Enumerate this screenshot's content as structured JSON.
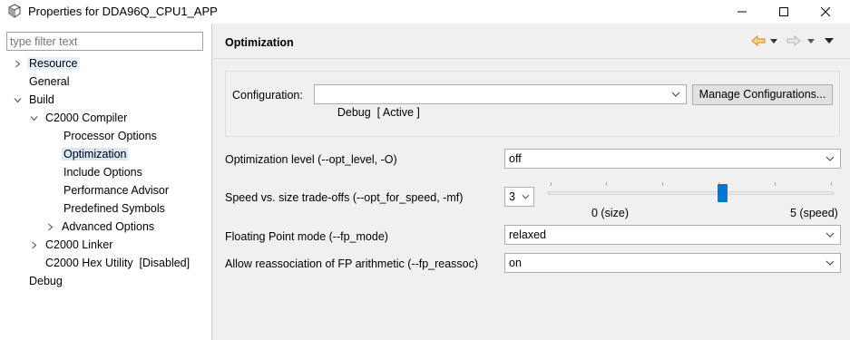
{
  "window": {
    "title": "Properties for DDA96Q_CPU1_APP",
    "minimize_icon": "minimize-icon",
    "maximize_icon": "maximize-icon",
    "close_icon": "close-icon"
  },
  "filter": {
    "placeholder": "type filter text"
  },
  "tree": {
    "resource": "Resource",
    "general": "General",
    "build": "Build",
    "c2000_compiler": "C2000 Compiler",
    "processor_options": "Processor Options",
    "optimization": "Optimization",
    "include_options": "Include Options",
    "performance_advisor": "Performance Advisor",
    "predefined_symbols": "Predefined Symbols",
    "advanced_options": "Advanced Options",
    "c2000_linker": "C2000 Linker",
    "c2000_hex_utility": "C2000 Hex Utility  [Disabled]",
    "debug": "Debug"
  },
  "page": {
    "title": "Optimization"
  },
  "configuration": {
    "label": "Configuration:",
    "value": "Debug  [ Active ]",
    "manage_button": "Manage Configurations..."
  },
  "settings": {
    "opt_level_label": "Optimization level (--opt_level, -O)",
    "opt_level_value": "off",
    "speed_label": "Speed vs. size trade-offs (--opt_for_speed, -mf)",
    "speed_value": "3",
    "speed_min_label": "0 (size)",
    "speed_max_label": "5 (speed)",
    "speed_slider_fraction": 0.6,
    "fp_mode_label": "Floating Point mode (--fp_mode)",
    "fp_mode_value": "relaxed",
    "fp_reassoc_label": "Allow reassociation of FP arithmetic (--fp_reassoc)",
    "fp_reassoc_value": "on"
  },
  "colors": {
    "accent": "#0078d7",
    "selection": "#d9e8f7",
    "nav_back_arrow": "#e8a33a",
    "nav_forward_arrow": "#b8b8b8"
  }
}
